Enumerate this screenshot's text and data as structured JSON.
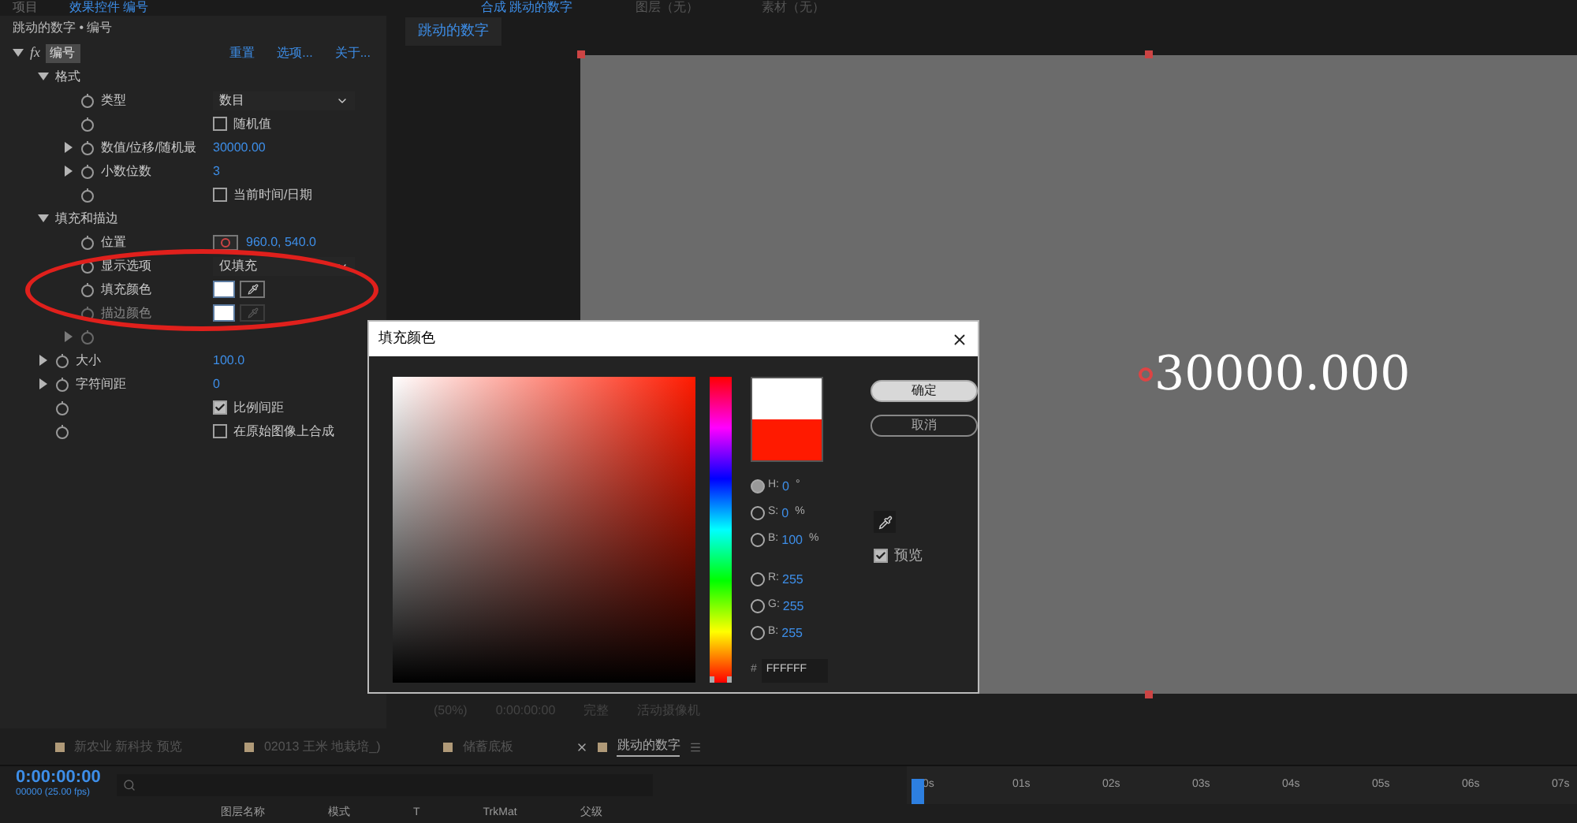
{
  "left_panel": {
    "tabs": [
      {
        "label": "项目",
        "selected": false
      },
      {
        "label": "效果控件 编号",
        "selected": true
      }
    ],
    "breadcrumb": "跳动的数字 • 编号",
    "effect": {
      "fx_label": "fx",
      "name": "编号",
      "expanded": true,
      "links": [
        "重置",
        "选项...",
        "关于..."
      ]
    },
    "properties": [
      {
        "kind": "group",
        "label": "格式",
        "expanded": true,
        "children": [
          {
            "kind": "dropdown",
            "label": "类型",
            "value": "数目",
            "disabled": false
          },
          {
            "kind": "checkbox",
            "text": "随机值",
            "checked": false,
            "disabled": false
          },
          {
            "kind": "number",
            "label": "数值/位移/随机最",
            "value": "30000.00",
            "expanded": false,
            "disabled": false
          },
          {
            "kind": "number",
            "label": "小数位数",
            "value": "3",
            "expanded": false,
            "disabled": false
          },
          {
            "kind": "checkbox",
            "text": "当前时间/日期",
            "checked": false,
            "disabled": false
          }
        ]
      },
      {
        "kind": "group",
        "label": "填充和描边",
        "expanded": true,
        "children": [
          {
            "kind": "point",
            "label": "位置",
            "value": "960.0, 540.0",
            "disabled": false
          },
          {
            "kind": "dropdown",
            "label": "显示选项",
            "value": "仅填充",
            "disabled": false
          },
          {
            "kind": "color",
            "label": "填充颜色",
            "color": "#ffffff",
            "disabled": false
          },
          {
            "kind": "color",
            "label": "描边颜色",
            "color": "#ffffff",
            "disabled": true
          },
          {
            "kind": "number",
            "expanded": false,
            "disabled": true
          }
        ]
      },
      {
        "kind": "number",
        "label": "大小",
        "value": "100.0",
        "expanded": false,
        "disabled": false
      },
      {
        "kind": "number",
        "label": "字符间距",
        "value": "0",
        "expanded": false,
        "disabled": false
      },
      {
        "kind": "checkbox",
        "text": "比例间距",
        "checked": true,
        "disabled": false
      },
      {
        "kind": "checkbox",
        "text": "在原始图像上合成",
        "checked": false,
        "disabled": false
      }
    ]
  },
  "viewer": {
    "tabs": [
      {
        "label": "合成 跳动的数字",
        "selected": true
      },
      {
        "label": "图层（无）",
        "selected": false
      },
      {
        "label": "素材（无）",
        "selected": false
      }
    ],
    "comp_tab": "跳动的数字",
    "canvas_text": "30000.000",
    "toolbar": [
      "(50%)",
      "0:00:00:00",
      "完整",
      "活动摄像机"
    ]
  },
  "dialog": {
    "title": "填充颜色",
    "buttons": [
      "确定",
      "取消"
    ],
    "channels": [
      {
        "label": "H:",
        "value": "0",
        "unit": "°",
        "selected": true
      },
      {
        "label": "S:",
        "value": "0",
        "unit": "%",
        "selected": false
      },
      {
        "label": "B:",
        "value": "100",
        "unit": "%",
        "selected": false
      },
      {
        "label": "R:",
        "value": "255",
        "selected": false
      },
      {
        "label": "G:",
        "value": "255",
        "selected": false
      },
      {
        "label": "B:",
        "value": "255",
        "selected": false
      }
    ],
    "hue": {
      "level": 0
    },
    "hex_label": "#",
    "hex": "FFFFFF",
    "preview": {
      "label": "预览",
      "checked": true
    }
  },
  "timeline": {
    "tabs": [
      {
        "label": "新农业 新科技 预览",
        "selected": false,
        "color": "#b09a78"
      },
      {
        "label": "02013 王米 地栽培_)",
        "selected": false,
        "color": "#b09a78"
      },
      {
        "label": "储蓄底板",
        "selected": false,
        "color": "#b09a78"
      },
      {
        "label": "跳动的数字",
        "selected": true,
        "color": "#b09a78"
      }
    ],
    "timecode": "0:00:00:00",
    "fps": "00000 (25.00 fps)",
    "ruler": [
      "0s",
      "01s",
      "02s",
      "03s",
      "04s",
      "05s",
      "06s",
      "07s"
    ],
    "columns": [
      "图层名称",
      "模式",
      "T",
      "TrkMat",
      "父级"
    ]
  }
}
